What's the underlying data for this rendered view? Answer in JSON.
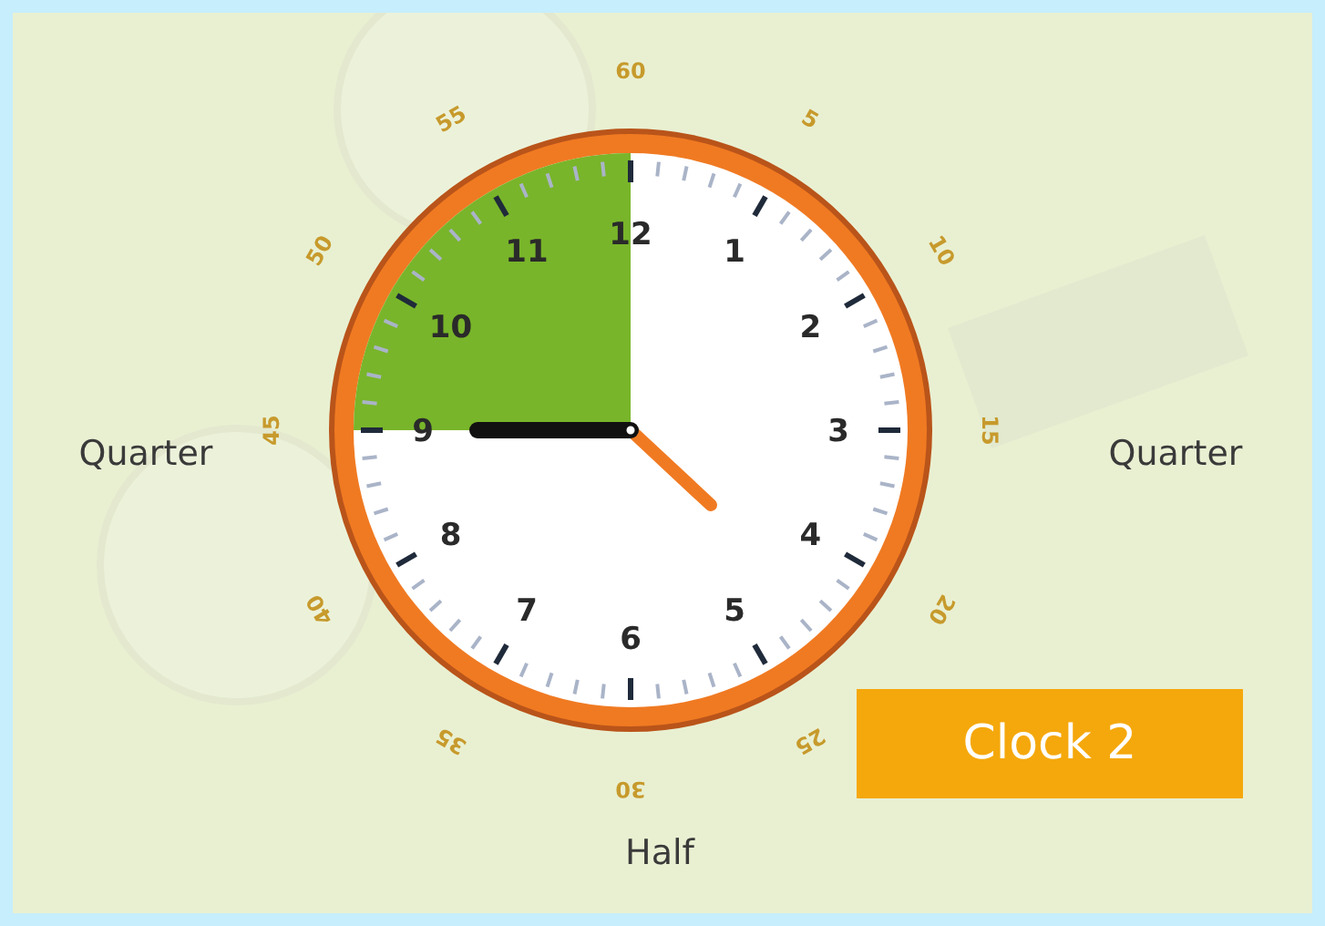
{
  "clock": {
    "hour_numbers": [
      "12",
      "1",
      "2",
      "3",
      "4",
      "5",
      "6",
      "7",
      "8",
      "9",
      "10",
      "11"
    ],
    "minute_labels": [
      "60",
      "5",
      "10",
      "15",
      "20",
      "25",
      "30",
      "35",
      "40",
      "45",
      "50",
      "55"
    ],
    "shaded": {
      "level": 0.25
    }
  },
  "side_labels": {
    "left": "Quarter",
    "right": "Quarter",
    "bottom": "Half"
  },
  "button": {
    "label": "Clock 2"
  }
}
